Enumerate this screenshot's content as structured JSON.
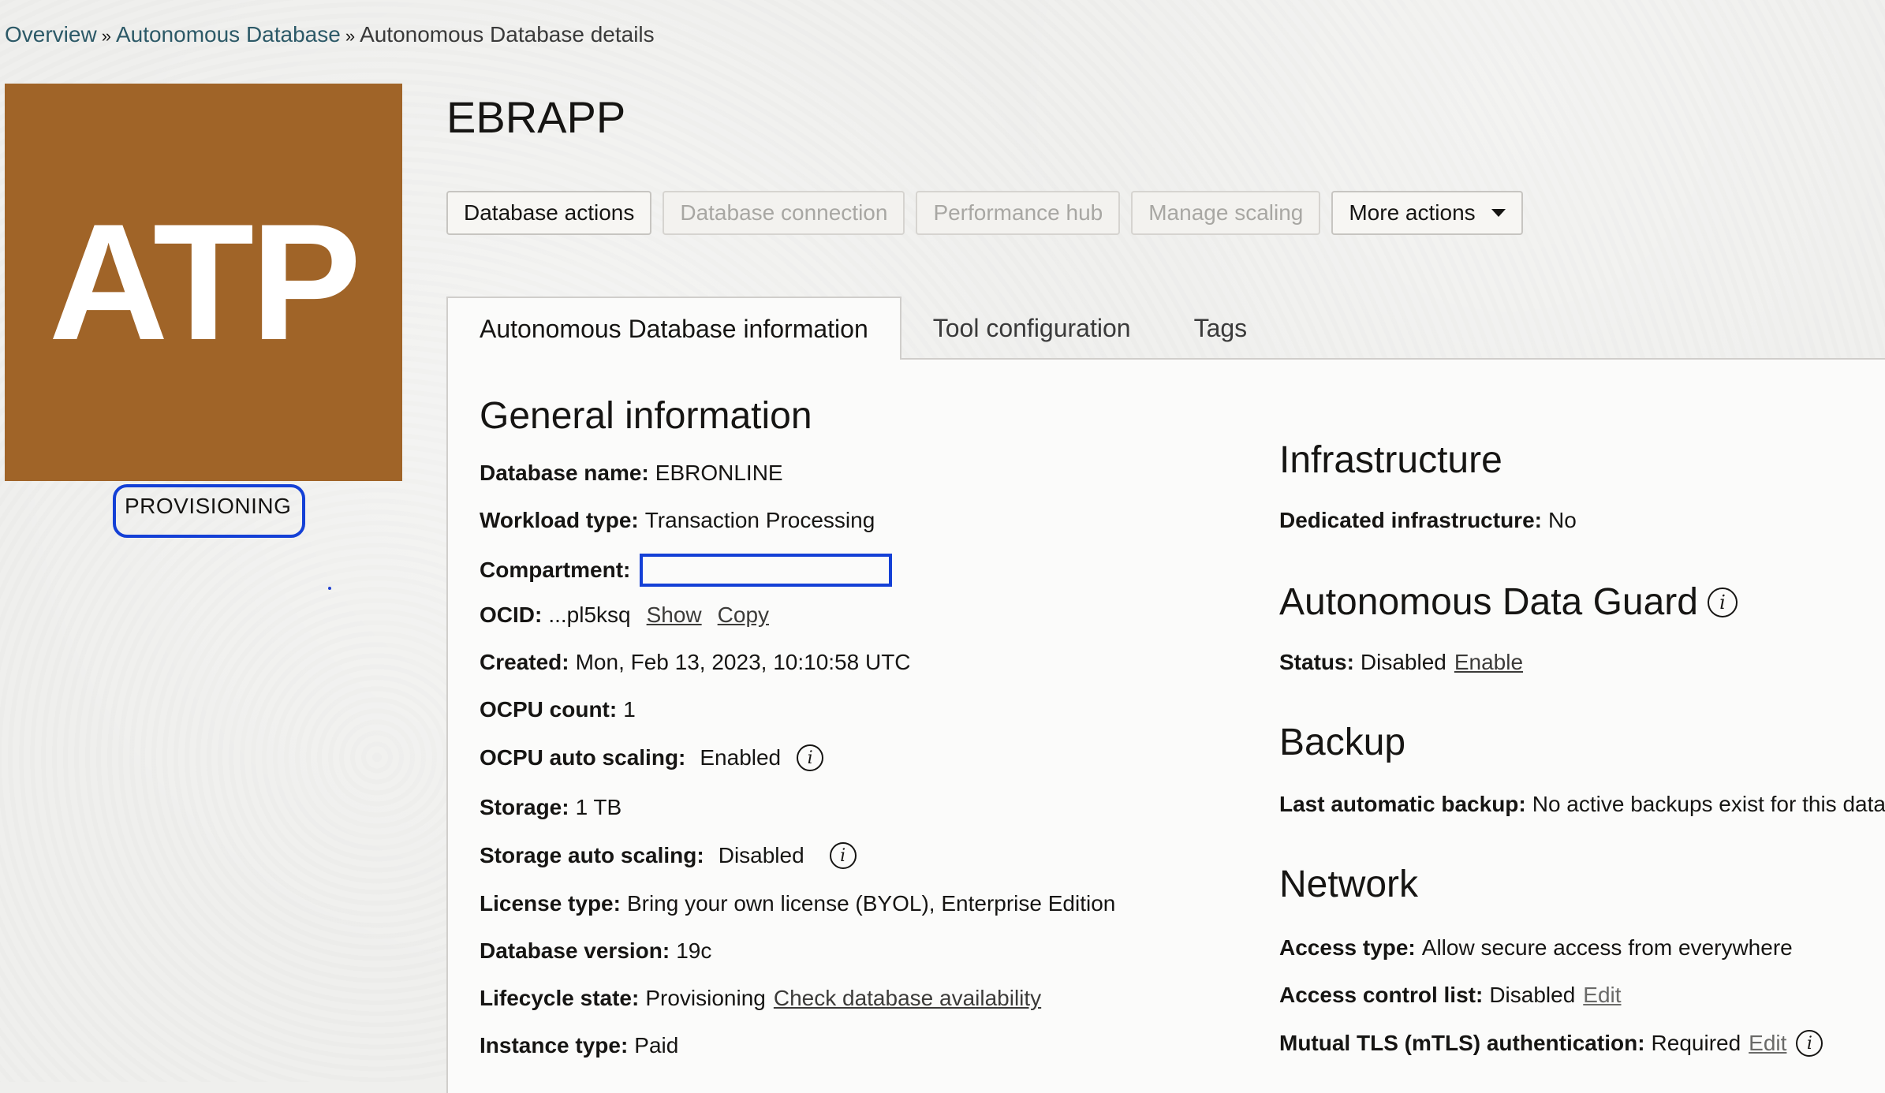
{
  "breadcrumb": {
    "items": [
      "Overview",
      "Autonomous Database"
    ],
    "separator": "»",
    "current": "Autonomous Database details"
  },
  "badge": {
    "text": "ATP",
    "color": "#a06428"
  },
  "status": {
    "label": "PROVISIONING"
  },
  "header": {
    "title": "EBRAPP"
  },
  "actions": {
    "database_actions": "Database actions",
    "database_connection": "Database connection",
    "performance_hub": "Performance hub",
    "manage_scaling": "Manage scaling",
    "more_actions": "More actions"
  },
  "tabs": [
    {
      "label": "Autonomous Database information",
      "active": true
    },
    {
      "label": "Tool configuration",
      "active": false
    },
    {
      "label": "Tags",
      "active": false
    }
  ],
  "general": {
    "title": "General information",
    "database_name": {
      "label": "Database name:",
      "value": "EBRONLINE"
    },
    "workload_type": {
      "label": "Workload type:",
      "value": "Transaction Processing"
    },
    "compartment": {
      "label": "Compartment:",
      "value": ""
    },
    "ocid": {
      "label": "OCID:",
      "value": "...pl5ksq",
      "show": "Show",
      "copy": "Copy"
    },
    "created": {
      "label": "Created:",
      "value": "Mon, Feb 13, 2023, 10:10:58 UTC"
    },
    "ocpu_count": {
      "label": "OCPU count:",
      "value": "1"
    },
    "ocpu_auto_scaling": {
      "label": "OCPU auto scaling:",
      "value": "Enabled"
    },
    "storage": {
      "label": "Storage:",
      "value": "1 TB"
    },
    "storage_auto_scaling": {
      "label": "Storage auto scaling:",
      "value": "Disabled"
    },
    "license_type": {
      "label": "License type:",
      "value": "Bring your own license (BYOL), Enterprise Edition"
    },
    "database_version": {
      "label": "Database version:",
      "value": "19c"
    },
    "lifecycle_state": {
      "label": "Lifecycle state:",
      "value": "Provisioning",
      "link": "Check database availability"
    },
    "instance_type": {
      "label": "Instance type:",
      "value": "Paid"
    }
  },
  "infrastructure": {
    "title": "Infrastructure",
    "dedicated": {
      "label": "Dedicated infrastructure:",
      "value": "No"
    }
  },
  "data_guard": {
    "title": "Autonomous Data Guard",
    "status": {
      "label": "Status:",
      "value": "Disabled",
      "link": "Enable"
    }
  },
  "backup": {
    "title": "Backup",
    "last_backup": {
      "label": "Last automatic backup:",
      "value": "No active backups exist for this data"
    }
  },
  "network": {
    "title": "Network",
    "access_type": {
      "label": "Access type:",
      "value": "Allow secure access from everywhere"
    },
    "acl": {
      "label": "Access control list:",
      "value": "Disabled",
      "link": "Edit"
    },
    "mtls": {
      "label": "Mutual TLS (mTLS) authentication:",
      "value": "Required",
      "link": "Edit"
    }
  }
}
